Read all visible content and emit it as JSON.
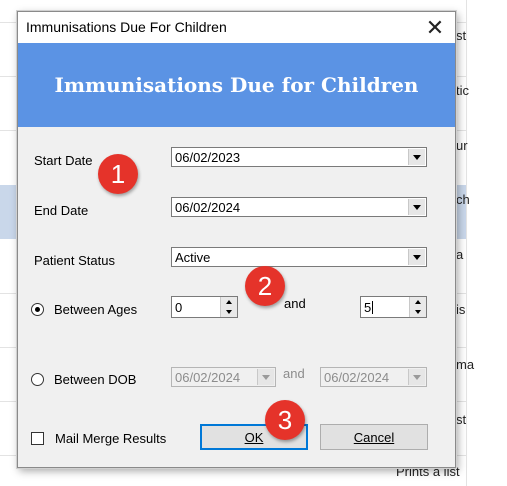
{
  "background": {
    "snippets": [
      "st",
      "tic",
      "ur",
      "ch",
      "a",
      "is",
      "ma",
      "st"
    ],
    "footer": "Prints a list"
  },
  "dialog": {
    "window_title": "Immunisations Due For Children",
    "close_glyph": "✕",
    "banner_title": "Immunisations Due for Children",
    "start_date": {
      "label": "Start Date",
      "value": "06/02/2023"
    },
    "end_date": {
      "label": "End Date",
      "value": "06/02/2024"
    },
    "patient_status": {
      "label": "Patient Status",
      "value": "Active"
    },
    "between_ages": {
      "label": "Between Ages",
      "selected": true,
      "from": "0",
      "connector": "and",
      "to": "5"
    },
    "between_dob": {
      "label": "Between DOB",
      "selected": false,
      "from": "06/02/2024",
      "connector": "and",
      "to": "06/02/2024"
    },
    "mail_merge": {
      "label": "Mail Merge Results",
      "checked": false
    },
    "ok_label": "OK",
    "cancel_label": "Cancel"
  },
  "markers": [
    "1",
    "2",
    "3"
  ],
  "colors": {
    "banner": "#5b93e4",
    "marker": "#e5332a",
    "selected_row": "#c9d7ea"
  }
}
